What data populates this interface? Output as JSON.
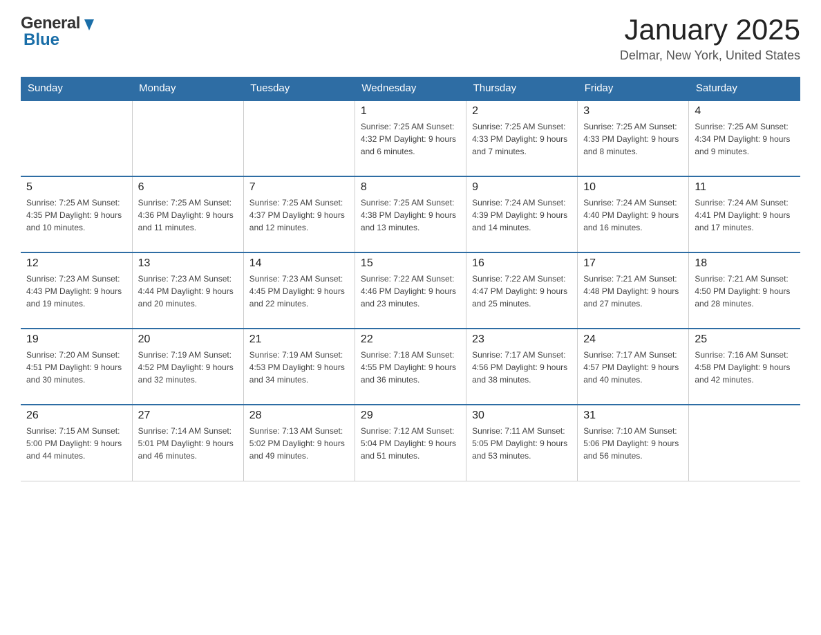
{
  "header": {
    "logo_general": "General",
    "logo_blue": "Blue",
    "title": "January 2025",
    "subtitle": "Delmar, New York, United States"
  },
  "days_of_week": [
    "Sunday",
    "Monday",
    "Tuesday",
    "Wednesday",
    "Thursday",
    "Friday",
    "Saturday"
  ],
  "weeks": [
    [
      {
        "day": "",
        "info": ""
      },
      {
        "day": "",
        "info": ""
      },
      {
        "day": "",
        "info": ""
      },
      {
        "day": "1",
        "info": "Sunrise: 7:25 AM\nSunset: 4:32 PM\nDaylight: 9 hours\nand 6 minutes."
      },
      {
        "day": "2",
        "info": "Sunrise: 7:25 AM\nSunset: 4:33 PM\nDaylight: 9 hours\nand 7 minutes."
      },
      {
        "day": "3",
        "info": "Sunrise: 7:25 AM\nSunset: 4:33 PM\nDaylight: 9 hours\nand 8 minutes."
      },
      {
        "day": "4",
        "info": "Sunrise: 7:25 AM\nSunset: 4:34 PM\nDaylight: 9 hours\nand 9 minutes."
      }
    ],
    [
      {
        "day": "5",
        "info": "Sunrise: 7:25 AM\nSunset: 4:35 PM\nDaylight: 9 hours\nand 10 minutes."
      },
      {
        "day": "6",
        "info": "Sunrise: 7:25 AM\nSunset: 4:36 PM\nDaylight: 9 hours\nand 11 minutes."
      },
      {
        "day": "7",
        "info": "Sunrise: 7:25 AM\nSunset: 4:37 PM\nDaylight: 9 hours\nand 12 minutes."
      },
      {
        "day": "8",
        "info": "Sunrise: 7:25 AM\nSunset: 4:38 PM\nDaylight: 9 hours\nand 13 minutes."
      },
      {
        "day": "9",
        "info": "Sunrise: 7:24 AM\nSunset: 4:39 PM\nDaylight: 9 hours\nand 14 minutes."
      },
      {
        "day": "10",
        "info": "Sunrise: 7:24 AM\nSunset: 4:40 PM\nDaylight: 9 hours\nand 16 minutes."
      },
      {
        "day": "11",
        "info": "Sunrise: 7:24 AM\nSunset: 4:41 PM\nDaylight: 9 hours\nand 17 minutes."
      }
    ],
    [
      {
        "day": "12",
        "info": "Sunrise: 7:23 AM\nSunset: 4:43 PM\nDaylight: 9 hours\nand 19 minutes."
      },
      {
        "day": "13",
        "info": "Sunrise: 7:23 AM\nSunset: 4:44 PM\nDaylight: 9 hours\nand 20 minutes."
      },
      {
        "day": "14",
        "info": "Sunrise: 7:23 AM\nSunset: 4:45 PM\nDaylight: 9 hours\nand 22 minutes."
      },
      {
        "day": "15",
        "info": "Sunrise: 7:22 AM\nSunset: 4:46 PM\nDaylight: 9 hours\nand 23 minutes."
      },
      {
        "day": "16",
        "info": "Sunrise: 7:22 AM\nSunset: 4:47 PM\nDaylight: 9 hours\nand 25 minutes."
      },
      {
        "day": "17",
        "info": "Sunrise: 7:21 AM\nSunset: 4:48 PM\nDaylight: 9 hours\nand 27 minutes."
      },
      {
        "day": "18",
        "info": "Sunrise: 7:21 AM\nSunset: 4:50 PM\nDaylight: 9 hours\nand 28 minutes."
      }
    ],
    [
      {
        "day": "19",
        "info": "Sunrise: 7:20 AM\nSunset: 4:51 PM\nDaylight: 9 hours\nand 30 minutes."
      },
      {
        "day": "20",
        "info": "Sunrise: 7:19 AM\nSunset: 4:52 PM\nDaylight: 9 hours\nand 32 minutes."
      },
      {
        "day": "21",
        "info": "Sunrise: 7:19 AM\nSunset: 4:53 PM\nDaylight: 9 hours\nand 34 minutes."
      },
      {
        "day": "22",
        "info": "Sunrise: 7:18 AM\nSunset: 4:55 PM\nDaylight: 9 hours\nand 36 minutes."
      },
      {
        "day": "23",
        "info": "Sunrise: 7:17 AM\nSunset: 4:56 PM\nDaylight: 9 hours\nand 38 minutes."
      },
      {
        "day": "24",
        "info": "Sunrise: 7:17 AM\nSunset: 4:57 PM\nDaylight: 9 hours\nand 40 minutes."
      },
      {
        "day": "25",
        "info": "Sunrise: 7:16 AM\nSunset: 4:58 PM\nDaylight: 9 hours\nand 42 minutes."
      }
    ],
    [
      {
        "day": "26",
        "info": "Sunrise: 7:15 AM\nSunset: 5:00 PM\nDaylight: 9 hours\nand 44 minutes."
      },
      {
        "day": "27",
        "info": "Sunrise: 7:14 AM\nSunset: 5:01 PM\nDaylight: 9 hours\nand 46 minutes."
      },
      {
        "day": "28",
        "info": "Sunrise: 7:13 AM\nSunset: 5:02 PM\nDaylight: 9 hours\nand 49 minutes."
      },
      {
        "day": "29",
        "info": "Sunrise: 7:12 AM\nSunset: 5:04 PM\nDaylight: 9 hours\nand 51 minutes."
      },
      {
        "day": "30",
        "info": "Sunrise: 7:11 AM\nSunset: 5:05 PM\nDaylight: 9 hours\nand 53 minutes."
      },
      {
        "day": "31",
        "info": "Sunrise: 7:10 AM\nSunset: 5:06 PM\nDaylight: 9 hours\nand 56 minutes."
      },
      {
        "day": "",
        "info": ""
      }
    ]
  ]
}
